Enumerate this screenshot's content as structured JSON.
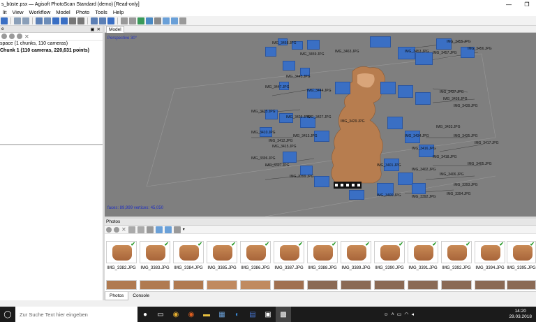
{
  "window": {
    "title": "s_büste.psx — Agisoft PhotoScan Standard (demo) [Read-only]",
    "buttons": [
      "—",
      "❐"
    ]
  },
  "menu": [
    "lit",
    "View",
    "Workflow",
    "Model",
    "Photo",
    "Tools",
    "Help"
  ],
  "workspace": {
    "header": "e",
    "line1": "space (1 chunks, 110 cameras)",
    "line2": "Chunk 1 (110 cameras, 220,631 points)"
  },
  "model": {
    "tab": "Model",
    "view_label": "Perspective 30°",
    "status": "faces: 89,999 vertices: 45,050",
    "camera_labels": [
      "IMG_3455.JPG",
      "IMG_3456.JPG",
      "IMG_3457.JPG",
      "IMG_3458.JPG",
      "IMG_3459.JPG",
      "IMG_3460.JPG",
      "IMG_3461.JPG",
      "IMG_3462.JPG",
      "IMG_3463.JPG",
      "IMG_3444.JPG",
      "IMG_3445.JPG",
      "IMG_3447.JPG",
      "IMG_3448.JPG",
      "IMG_3449.JPG",
      "IMG_3450.JPG",
      "IMG_3451.JPG",
      "IMG_3452.JPG",
      "IMG_3453.JPG",
      "IMG_3437.JPG",
      "IMG_3438.JPG",
      "IMG_3439.JPG",
      "IMG_3440.JPG",
      "IMG_3441.JPG",
      "IMG_3442.JPG",
      "IMG_3425.JPG",
      "IMG_3426.JPG",
      "IMG_3427.JPG",
      "IMG_3428.JPG",
      "IMG_3429.JPG",
      "IMG_3430.JPG",
      "IMG_3431.JPG",
      "IMG_3432.JPG",
      "IMG_3433.JPG",
      "IMG_3434.JPG",
      "IMG_3435.JPG",
      "IMG_3436.JPG",
      "IMG_3410.JPG",
      "IMG_3411.JPG",
      "IMG_3412.JPG",
      "IMG_3413.JPG",
      "IMG_3414.JPG",
      "IMG_3415.JPG",
      "IMG_3416.JPG",
      "IMG_3417.JPG",
      "IMG_3418.JPG",
      "IMG_3419.JPG",
      "IMG_3420.JPG",
      "IMG_3421.JPG",
      "IMG_3396.JPG",
      "IMG_3397.JPG",
      "IMG_3398.JPG",
      "IMG_3399.JPG",
      "IMG_3400.JPG",
      "IMG_3401.JPG",
      "IMG_3402.JPG",
      "IMG_3403.JPG",
      "IMG_3404.JPG",
      "IMG_3405.JPG",
      "IMG_3406.JPG",
      "IMG_3390.JPG",
      "IMG_3391.JPG",
      "IMG_3392.JPG",
      "IMG_3393.JPG",
      "IMG_3394.JPG",
      "IMG_3395.JPG",
      "IMG_3383.JPG",
      "IMG_3384.JPG",
      "IMG_3385.JPG",
      "IMG_3386.JPG",
      "IMG_3387.JPG",
      "IMG_3388.JPG",
      "IMG_3389.JPG"
    ]
  },
  "photos": {
    "header": "Photos",
    "thumbnails": [
      "IMG_3382.JPG",
      "IMG_3383.JPG",
      "IMG_3384.JPG",
      "IMG_3385.JPG",
      "IMG_3386.JPG",
      "IMG_3387.JPG",
      "IMG_3388.JPG",
      "IMG_3389.JPG",
      "IMG_3390.JPG",
      "IMG_3391.JPG",
      "IMG_3392.JPG",
      "IMG_3394.JPG",
      "IMG_3395.JPG"
    ],
    "tabs": [
      "Photos",
      "Console"
    ]
  },
  "taskbar": {
    "search_placeholder": "Zur Suche Text hier eingeben",
    "time": "14:20",
    "date": "29.03.2018"
  },
  "colors": {
    "viewport_bg": "#7f7f7f",
    "camera_blue": "#3a6fc4",
    "label_blue": "#2030c0",
    "check_green": "#2a9a2a"
  }
}
